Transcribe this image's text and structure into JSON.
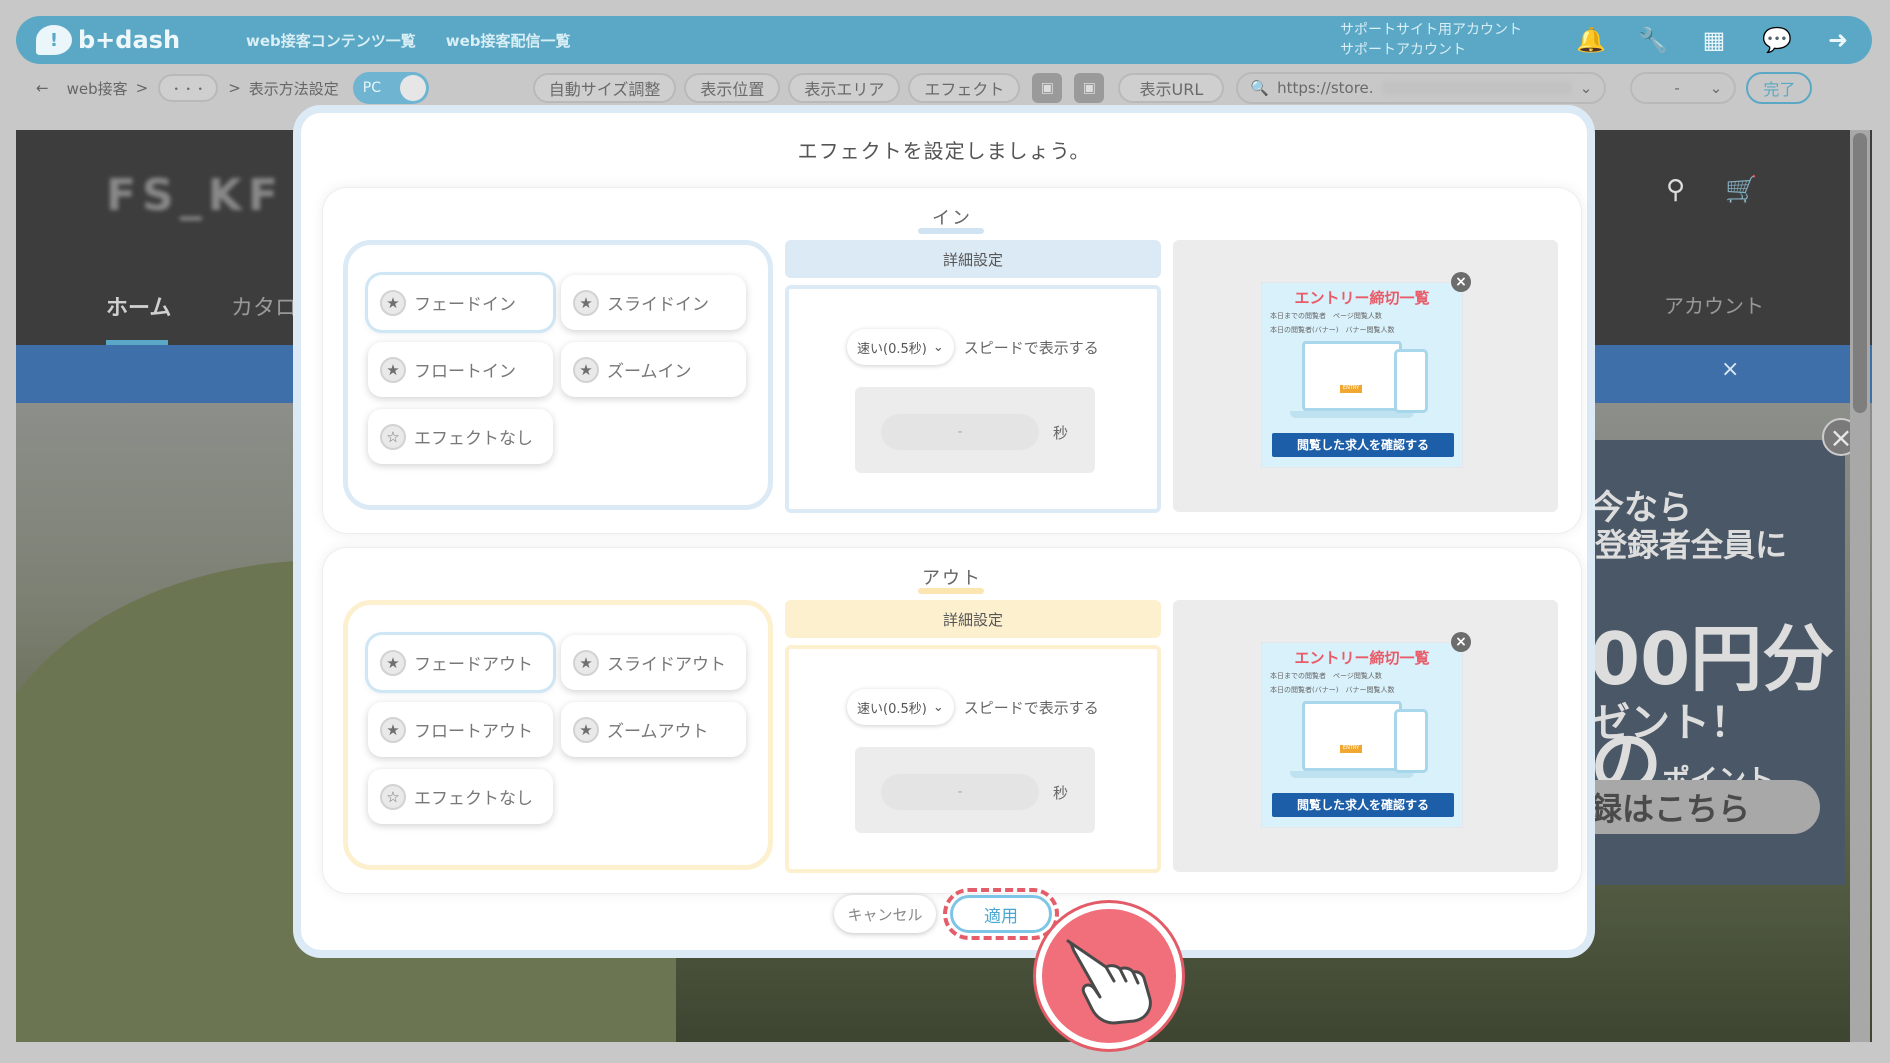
{
  "topbar": {
    "brand": "b+dash",
    "links": [
      "web接客コンテンツ一覧",
      "web接客配信一覧"
    ],
    "account_line1": "サポートサイト用アカウント",
    "account_line2": "サポートアカウント",
    "icons": [
      "bell-icon",
      "wrench-icon",
      "grid-icon",
      "chat-icon",
      "logout-icon"
    ]
  },
  "toolbar": {
    "back": "←",
    "crumb1": "web接客",
    "sep": ">",
    "ellipsis": "・・・",
    "crumb2": "表示方法設定",
    "device": "PC",
    "buttons": [
      "自動サイズ調整",
      "表示位置",
      "表示エリア",
      "エフェクト"
    ],
    "show_url": "表示URL",
    "url": "https://store.",
    "select_value": "-",
    "done": "完了"
  },
  "site": {
    "logo": "FS_KF",
    "nav_home": "ホーム",
    "nav_catalog": "カタロ",
    "nav_account": "アカウント",
    "banner_close": "×",
    "promo_line1": "今なら",
    "promo_line2": "登録者全員に",
    "promo_line3": "00円分の",
    "promo_line3b": "ポイント",
    "promo_line4": "ゼント！",
    "promo_button": "録はこちら"
  },
  "modal": {
    "title": "エフェクトを設定しましょう。",
    "in": {
      "label": "イン",
      "options": [
        "フェードイン",
        "スライドイン",
        "フロートイン",
        "ズームイン",
        "エフェクトなし"
      ],
      "selected": "フェードイン",
      "detail_title": "詳細設定",
      "speed": "速い(0.5秒)",
      "speed_text": "スピードで表示する",
      "seconds_value": "-",
      "seconds_unit": "秒"
    },
    "out": {
      "label": "アウト",
      "options": [
        "フェードアウト",
        "スライドアウト",
        "フロートアウト",
        "ズームアウト",
        "エフェクトなし"
      ],
      "selected": "フェードアウト",
      "detail_title": "詳細設定",
      "speed": "速い(0.5秒)",
      "speed_text": "スピードで表示する",
      "seconds_value": "-",
      "seconds_unit": "秒"
    },
    "preview": {
      "title": "エントリー締切一覧",
      "sub1": "本日までの閲覧者　ページ閲覧人数",
      "sub2": "本日の閲覧者(バナー)　バナー閲覧人数",
      "entry": "ENTRY",
      "button": "閲覧した求人を確認する"
    },
    "cancel": "キャンセル",
    "apply": "適用"
  },
  "colors": {
    "in_accent": "#dceaf6",
    "out_accent": "#fdf0cf",
    "brand": "#5aa8c6",
    "highlight": "#e35d6a"
  }
}
